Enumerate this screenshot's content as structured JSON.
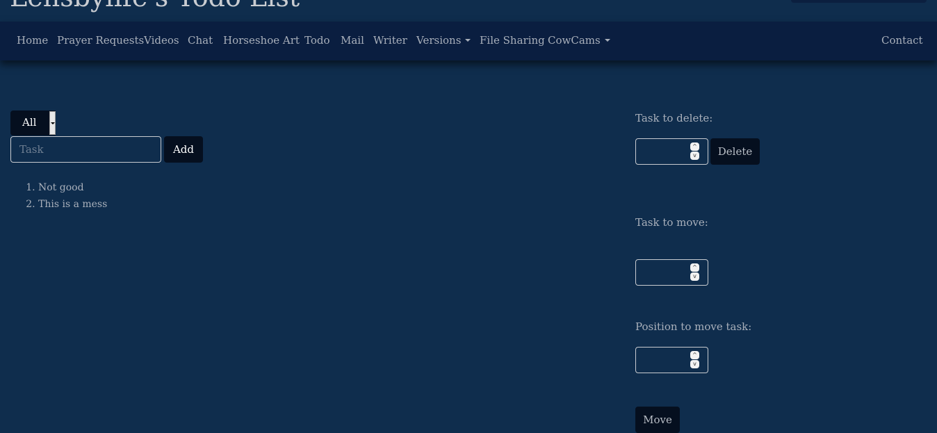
{
  "header": {
    "title": "Lensbylife's Todo List"
  },
  "nav": {
    "items": [
      {
        "label": "Home"
      },
      {
        "label": "Prayer Requests"
      },
      {
        "label": "Videos"
      },
      {
        "label": "Chat"
      },
      {
        "label": "Horseshoe Art"
      },
      {
        "label": "Todo"
      },
      {
        "label": "Mail"
      },
      {
        "label": "Writer"
      },
      {
        "label": "Versions"
      },
      {
        "label": "File Sharing"
      },
      {
        "label": "CowCams"
      }
    ],
    "contact": "Contact"
  },
  "todo": {
    "filter": "All",
    "task_placeholder": "Task",
    "add_label": "Add",
    "tasks": [
      "Not good",
      "This is a mess"
    ]
  },
  "side": {
    "delete_label": "Task to delete:",
    "delete_button": "Delete",
    "move_label": "Task to move:",
    "position_label": "Position to move task:",
    "move_button": "Move"
  }
}
